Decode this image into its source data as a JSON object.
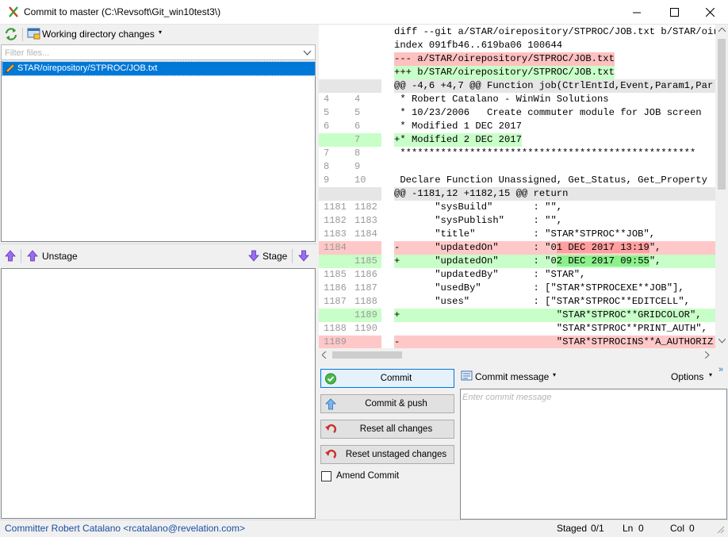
{
  "window": {
    "title": "Commit to master (C:\\Revsoft\\Git_win10test3\\)",
    "minimize_icon": "minimize-icon",
    "maximize_icon": "maximize-icon",
    "close_icon": "close-icon"
  },
  "toolbar": {
    "refresh_icon": "refresh-icon",
    "working_dir_label": "Working directory changes",
    "working_dir_caret": "▾"
  },
  "filter": {
    "placeholder": "Filter files...",
    "value": ""
  },
  "unstaged_files": [
    {
      "name": "STAR/oirepository/STPROC/JOB.txt",
      "icon": "pencil-icon",
      "selected": true
    }
  ],
  "stage_bar": {
    "unstage_label": "Unstage",
    "stage_label": "Stage"
  },
  "diff": {
    "lines": [
      {
        "kind": "hdr",
        "n1": "",
        "n2": "",
        "text": "diff --git a/STAR/oirepository/STPROC/JOB.txt b/STAR/oire"
      },
      {
        "kind": "hdr",
        "n1": "",
        "n2": "",
        "text": "index 091fb46..619ba06 100644"
      },
      {
        "kind": "meta",
        "n1": "",
        "n2": "",
        "text": "--- a/STAR/oirepository/STPROC/JOB.txt"
      },
      {
        "kind": "metaadd",
        "n1": "",
        "n2": "",
        "text": "+++ b/STAR/oirepository/STPROC/JOB.txt"
      },
      {
        "kind": "hunk",
        "n1": "",
        "n2": "",
        "text": "@@ -4,6 +4,7 @@ Function job(CtrlEntId,Event,Param1,Par"
      },
      {
        "kind": "ctx",
        "n1": "4",
        "n2": "4",
        "text": " * Robert Catalano - WinWin Solutions"
      },
      {
        "kind": "ctx",
        "n1": "5",
        "n2": "5",
        "text": " * 10/23/2006   Create commuter module for JOB screen"
      },
      {
        "kind": "ctx",
        "n1": "6",
        "n2": "6",
        "text": " * Modified 1 DEC 2017"
      },
      {
        "kind": "add",
        "n1": "",
        "n2": "7",
        "text": "+* Modified 2 DEC 2017"
      },
      {
        "kind": "ctx",
        "n1": "7",
        "n2": "8",
        "text": " ***************************************************"
      },
      {
        "kind": "ctx",
        "n1": "8",
        "n2": "9",
        "text": ""
      },
      {
        "kind": "ctx",
        "n1": "9",
        "n2": "10",
        "text": " Declare Function Unassigned, Get_Status, Get_Property"
      },
      {
        "kind": "hunk",
        "n1": "",
        "n2": "",
        "text": "@@ -1181,12 +1182,15 @@ return"
      },
      {
        "kind": "ctx",
        "n1": "1181",
        "n2": "1182",
        "text": "       \"sysBuild\"       : \"\","
      },
      {
        "kind": "ctx",
        "n1": "1182",
        "n2": "1183",
        "text": "       \"sysPublish\"     : \"\","
      },
      {
        "kind": "ctx",
        "n1": "1183",
        "n2": "1184",
        "text": "       \"title\"          : \"STAR*STPROC**JOB\","
      },
      {
        "kind": "del",
        "n1": "1184",
        "n2": "",
        "pre": "-      \"updatedOn\"      : \"0",
        "hl": "1 DEC 2017 13:19",
        "post": "\","
      },
      {
        "kind": "add",
        "n1": "",
        "n2": "1185",
        "pre": "+      \"updatedOn\"      : \"0",
        "hl": "2 DEC 2017 09:55",
        "post": "\","
      },
      {
        "kind": "ctx",
        "n1": "1185",
        "n2": "1186",
        "text": "       \"updatedBy\"      : \"STAR\","
      },
      {
        "kind": "ctx",
        "n1": "1186",
        "n2": "1187",
        "text": "       \"usedBy\"         : [\"STAR*STPROCEXE**JOB\"],"
      },
      {
        "kind": "ctx",
        "n1": "1187",
        "n2": "1188",
        "text": "       \"uses\"           : [\"STAR*STPROC**EDITCELL\","
      },
      {
        "kind": "add",
        "n1": "",
        "n2": "1189",
        "text": "+                           \"STAR*STPROC**GRIDCOLOR\","
      },
      {
        "kind": "ctx",
        "n1": "1188",
        "n2": "1190",
        "text": "                            \"STAR*STPROC**PRINT_AUTH\","
      },
      {
        "kind": "del",
        "n1": "1189",
        "n2": "",
        "text": "-                           \"STAR*STPROCINS**A_AUTHORIZ"
      }
    ]
  },
  "buttons": {
    "commit": "Commit",
    "commit_push": "Commit & push",
    "reset_all": "Reset all changes",
    "reset_unstaged": "Reset unstaged changes",
    "amend": "Amend Commit"
  },
  "commit_message": {
    "header_label": "Commit message",
    "caret": "▾",
    "options_label": "Options",
    "more": "»",
    "placeholder": "Enter commit message",
    "value": ""
  },
  "status": {
    "committer": "Committer Robert Catalano <rcatalano@revelation.com>",
    "staged_label": "Staged",
    "staged_value": "0/1",
    "ln_label": "Ln",
    "ln_value": "0",
    "col_label": "Col",
    "col_value": "0"
  }
}
